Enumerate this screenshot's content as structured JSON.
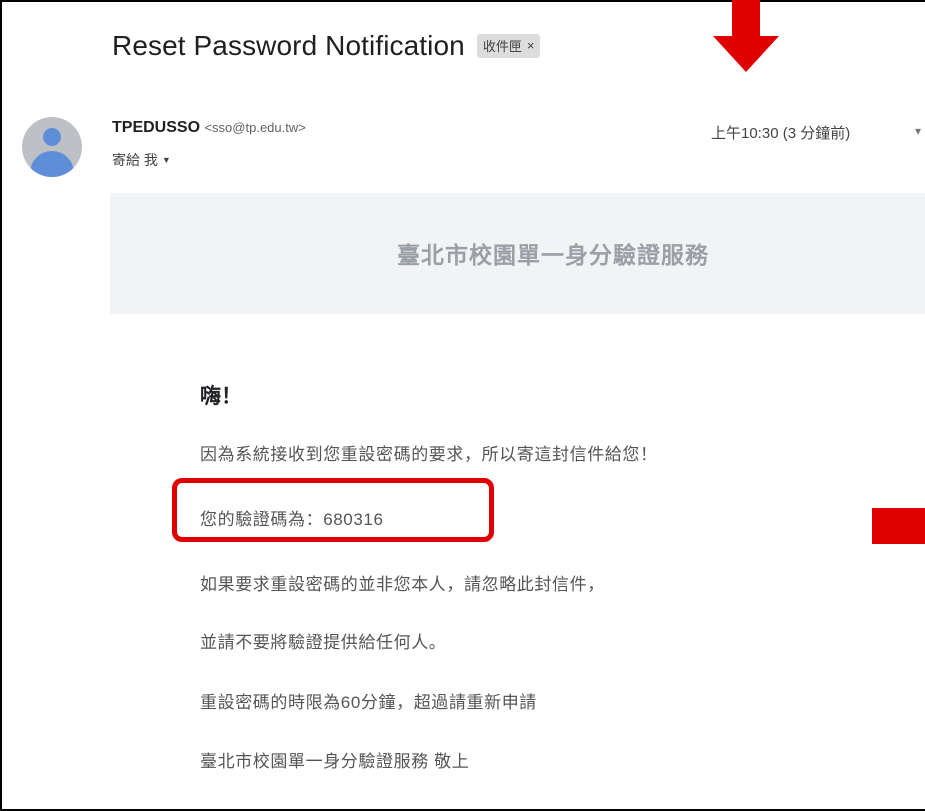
{
  "email": {
    "subject": "Reset Password Notification",
    "label": "收件匣",
    "label_close": "×",
    "sender_name": "TPEDUSSO",
    "sender_email": "<sso@tp.edu.tw>",
    "recipient": "寄給 我",
    "timestamp": "上午10:30 (3 分鐘前)"
  },
  "body": {
    "banner_title": "臺北市校園單一身分驗證服務",
    "greeting": "嗨！",
    "line1": "因為系統接收到您重設密碼的要求，所以寄這封信件給您！",
    "code_line": "您的驗證碼為：680316",
    "line3": "如果要求重設密碼的並非您本人，請忽略此封信件，",
    "line4": "並請不要將驗證提供給任何人。",
    "line5": "重設密碼的時限為60分鐘，超過請重新申請",
    "signature": "臺北市校園單一身分驗證服務 敬上"
  },
  "annotations": {
    "highlight_color": "#e00000"
  },
  "icons": {
    "avatar": "person-avatar-icon",
    "recipient_dropdown": "caret-down-icon",
    "more": "more-icon"
  }
}
